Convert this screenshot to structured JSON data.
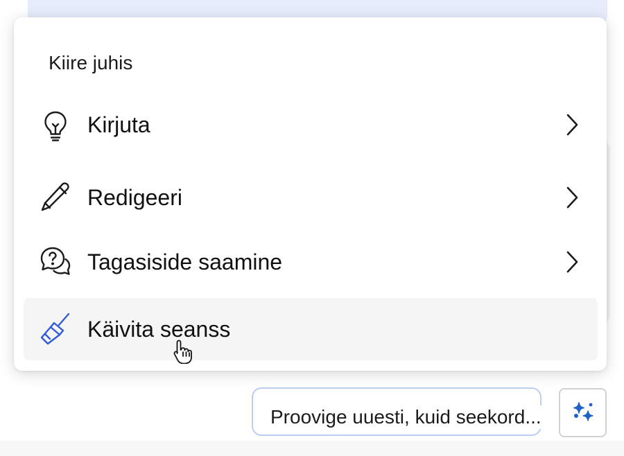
{
  "menu": {
    "title": "Kiire juhis",
    "items": [
      {
        "label": "Kirjuta",
        "icon": "lightbulb-icon",
        "has_submenu": true
      },
      {
        "label": "Redigeeri",
        "icon": "pencil-icon",
        "has_submenu": true
      },
      {
        "label": "Tagasiside saamine",
        "icon": "question-bubble-icon",
        "has_submenu": true
      },
      {
        "label": "Käivita seanss",
        "icon": "broom-icon",
        "has_submenu": false,
        "hovered": true
      }
    ]
  },
  "suggestion": {
    "text": "Proovige uuesti, kuid seekord..."
  },
  "sparkle_button": {
    "icon": "sparkle-icon"
  },
  "colors": {
    "accent": "#2f5cd6",
    "chip_border": "#b9cdf7",
    "hover_bg": "#f5f5f5",
    "top_bar": "#e6ecfb"
  }
}
